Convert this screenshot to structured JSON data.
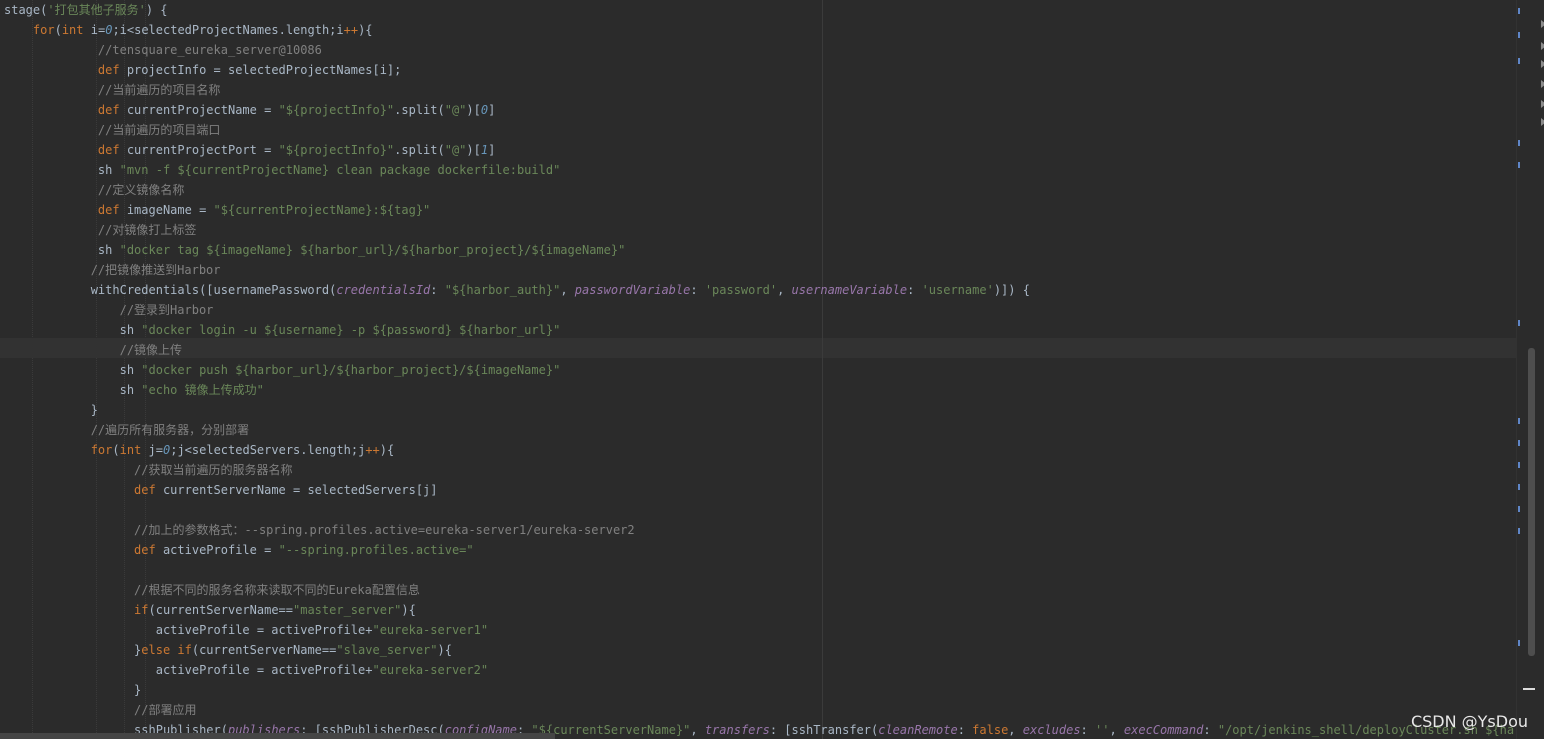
{
  "editor": {
    "colors": {
      "background": "#2b2b2b",
      "plain": "#a9b7c6",
      "keyword": "#cc7832",
      "string": "#6a8759",
      "comment": "#808080",
      "number": "#6897bb",
      "param": "#9876aa"
    },
    "lines": [
      {
        "tokens": [
          [
            "p",
            "stage("
          ],
          [
            "s",
            "'打包其他子服务'"
          ],
          [
            "p",
            ") {"
          ]
        ]
      },
      {
        "tokens": [
          [
            "p",
            "    "
          ],
          [
            "k",
            "for"
          ],
          [
            "p",
            "("
          ],
          [
            "k",
            "int"
          ],
          [
            "p",
            " i="
          ],
          [
            "n",
            "0"
          ],
          [
            "p",
            ";i<selectedProjectNames.length;i"
          ],
          [
            "k",
            "++"
          ],
          [
            "p",
            "){"
          ]
        ]
      },
      {
        "tokens": [
          [
            "p",
            "             "
          ],
          [
            "c",
            "//tensquare_eureka_server@10086"
          ]
        ]
      },
      {
        "tokens": [
          [
            "p",
            "             "
          ],
          [
            "k",
            "def"
          ],
          [
            "p",
            " projectInfo = selectedProjectNames[i];"
          ]
        ]
      },
      {
        "tokens": [
          [
            "p",
            "             "
          ],
          [
            "c",
            "//当前遍历的项目名称"
          ]
        ]
      },
      {
        "tokens": [
          [
            "p",
            "             "
          ],
          [
            "k",
            "def"
          ],
          [
            "p",
            " currentProjectName = "
          ],
          [
            "s",
            "\"${projectInfo}\""
          ],
          [
            "p",
            ".split("
          ],
          [
            "s",
            "\"@\""
          ],
          [
            "p",
            ")["
          ],
          [
            "n",
            "0"
          ],
          [
            "p",
            "]"
          ]
        ]
      },
      {
        "tokens": [
          [
            "p",
            "             "
          ],
          [
            "c",
            "//当前遍历的项目端口"
          ]
        ]
      },
      {
        "tokens": [
          [
            "p",
            "             "
          ],
          [
            "k",
            "def"
          ],
          [
            "p",
            " currentProjectPort = "
          ],
          [
            "s",
            "\"${projectInfo}\""
          ],
          [
            "p",
            ".split("
          ],
          [
            "s",
            "\"@\""
          ],
          [
            "p",
            ")["
          ],
          [
            "n",
            "1"
          ],
          [
            "p",
            "]"
          ]
        ]
      },
      {
        "tokens": [
          [
            "p",
            "             sh "
          ],
          [
            "s",
            "\"mvn -f ${currentProjectName} clean package dockerfile:build\""
          ]
        ]
      },
      {
        "tokens": [
          [
            "p",
            "             "
          ],
          [
            "c",
            "//定义镜像名称"
          ]
        ]
      },
      {
        "tokens": [
          [
            "p",
            "             "
          ],
          [
            "k",
            "def"
          ],
          [
            "p",
            " imageName = "
          ],
          [
            "s",
            "\"${currentProjectName}:${tag}\""
          ]
        ]
      },
      {
        "tokens": [
          [
            "p",
            "             "
          ],
          [
            "c",
            "//对镜像打上标签"
          ]
        ]
      },
      {
        "tokens": [
          [
            "p",
            "             sh "
          ],
          [
            "s",
            "\"docker tag ${imageName} ${harbor_url}/${harbor_project}/${imageName}\""
          ]
        ]
      },
      {
        "tokens": [
          [
            "p",
            "            "
          ],
          [
            "c",
            "//把镜像推送到Harbor"
          ]
        ]
      },
      {
        "tokens": [
          [
            "p",
            "            withCredentials([usernamePassword("
          ],
          [
            "a",
            "credentialsId"
          ],
          [
            "p",
            ": "
          ],
          [
            "s",
            "\"${harbor_auth}\""
          ],
          [
            "p",
            ", "
          ],
          [
            "a",
            "passwordVariable"
          ],
          [
            "p",
            ": "
          ],
          [
            "s",
            "'password'"
          ],
          [
            "p",
            ", "
          ],
          [
            "a",
            "usernameVariable"
          ],
          [
            "p",
            ": "
          ],
          [
            "s",
            "'username'"
          ],
          [
            "p",
            ")]) {"
          ]
        ]
      },
      {
        "tokens": [
          [
            "p",
            "                "
          ],
          [
            "c",
            "//登录到Harbor"
          ]
        ]
      },
      {
        "tokens": [
          [
            "p",
            "                sh "
          ],
          [
            "s",
            "\"docker login -u ${username} -p ${password} ${harbor_url}\""
          ]
        ]
      },
      {
        "tokens": [
          [
            "p",
            "                "
          ],
          [
            "c",
            "//镜像上传"
          ]
        ]
      },
      {
        "tokens": [
          [
            "p",
            "                sh "
          ],
          [
            "s",
            "\"docker push ${harbor_url}/${harbor_project}/${imageName}\""
          ]
        ]
      },
      {
        "tokens": [
          [
            "p",
            "                sh "
          ],
          [
            "s",
            "\"echo 镜像上传成功\""
          ]
        ]
      },
      {
        "tokens": [
          [
            "p",
            "            }"
          ]
        ]
      },
      {
        "tokens": [
          [
            "p",
            "            "
          ],
          [
            "c",
            "//遍历所有服务器，分别部署"
          ]
        ]
      },
      {
        "tokens": [
          [
            "p",
            "            "
          ],
          [
            "k",
            "for"
          ],
          [
            "p",
            "("
          ],
          [
            "k",
            "int"
          ],
          [
            "p",
            " j="
          ],
          [
            "n",
            "0"
          ],
          [
            "p",
            ";j<selectedServers.length;j"
          ],
          [
            "k",
            "++"
          ],
          [
            "p",
            "){"
          ]
        ]
      },
      {
        "tokens": [
          [
            "p",
            "                  "
          ],
          [
            "c",
            "//获取当前遍历的服务器名称"
          ]
        ]
      },
      {
        "tokens": [
          [
            "p",
            "                  "
          ],
          [
            "k",
            "def"
          ],
          [
            "p",
            " currentServerName = selectedServers[j]"
          ]
        ]
      },
      {
        "tokens": []
      },
      {
        "tokens": [
          [
            "p",
            "                  "
          ],
          [
            "c",
            "//加上的参数格式：--spring.profiles.active=eureka-server1/eureka-server2"
          ]
        ]
      },
      {
        "tokens": [
          [
            "p",
            "                  "
          ],
          [
            "k",
            "def"
          ],
          [
            "p",
            " activeProfile = "
          ],
          [
            "s",
            "\"--spring.profiles.active=\""
          ]
        ]
      },
      {
        "tokens": []
      },
      {
        "tokens": [
          [
            "p",
            "                  "
          ],
          [
            "c",
            "//根据不同的服务名称来读取不同的Eureka配置信息"
          ]
        ]
      },
      {
        "tokens": [
          [
            "p",
            "                  "
          ],
          [
            "k",
            "if"
          ],
          [
            "p",
            "(currentServerName=="
          ],
          [
            "s",
            "\"master_server\""
          ],
          [
            "p",
            "){"
          ]
        ]
      },
      {
        "tokens": [
          [
            "p",
            "                     activeProfile = activeProfile+"
          ],
          [
            "s",
            "\"eureka-server1\""
          ]
        ]
      },
      {
        "tokens": [
          [
            "p",
            "                  }"
          ],
          [
            "k",
            "else if"
          ],
          [
            "p",
            "(currentServerName=="
          ],
          [
            "s",
            "\"slave_server\""
          ],
          [
            "p",
            "){"
          ]
        ]
      },
      {
        "tokens": [
          [
            "p",
            "                     activeProfile = activeProfile+"
          ],
          [
            "s",
            "\"eureka-server2\""
          ]
        ]
      },
      {
        "tokens": [
          [
            "p",
            "                  }"
          ]
        ]
      },
      {
        "tokens": [
          [
            "p",
            "                  "
          ],
          [
            "c",
            "//部署应用"
          ]
        ]
      },
      {
        "tokens": [
          [
            "p",
            "                  sshPublisher("
          ],
          [
            "a",
            "publishers"
          ],
          [
            "p",
            ": [sshPublisherDesc("
          ],
          [
            "a",
            "configName"
          ],
          [
            "p",
            ": "
          ],
          [
            "s",
            "\"${currentServerName}\""
          ],
          [
            "p",
            ", "
          ],
          [
            "a",
            "transfers"
          ],
          [
            "p",
            ": [sshTransfer("
          ],
          [
            "a",
            "cleanRemote"
          ],
          [
            "p",
            ": "
          ],
          [
            "k",
            "false"
          ],
          [
            "p",
            ", "
          ],
          [
            "a",
            "excludes"
          ],
          [
            "p",
            ": "
          ],
          [
            "s",
            "''"
          ],
          [
            "p",
            ", "
          ],
          [
            "a",
            "execCommand"
          ],
          [
            "p",
            ": "
          ],
          [
            "s",
            "\"/opt/jenkins_shell/deployCluster.sh ${harbor_url"
          ]
        ]
      }
    ]
  },
  "watermark": "CSDN @YsDou"
}
